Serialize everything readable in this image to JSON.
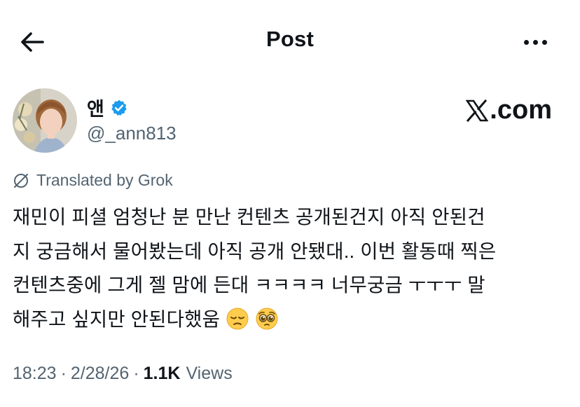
{
  "header": {
    "title": "Post",
    "back_icon": "arrow-left-icon",
    "more_icon": "more-horizontal-icon"
  },
  "author": {
    "name": "앤",
    "handle": "@_ann813",
    "verified_icon": "verified-badge-icon",
    "verified_color": "#1d9bf0"
  },
  "brand": {
    "suffix": ".com",
    "icon": "x-logo-icon"
  },
  "translation": {
    "label": "Translated by Grok",
    "icon": "translate-icon"
  },
  "post": {
    "lines": [
      "재민이 피셜 엄청난 분 만난 컨텐츠 공개된건지 아직 안된건",
      "지 궁금해서 물어봤는데 아직 공개 안됐대.. 이번 활동때 찍은",
      "컨텐츠중에 그게 젤 맘에 든대 ㅋㅋㅋㅋ 너무궁금 ㅜㅜㅜ  말",
      "해주고 싶지만 안된다했움"
    ],
    "emojis": [
      "pensive-face-emoji",
      "pleading-face-emoji"
    ]
  },
  "meta": {
    "time": "18:23",
    "separator": "·",
    "date": "2/28/26",
    "views_count": "1.1K",
    "views_label": "Views"
  },
  "colors": {
    "text": "#0f1419",
    "secondary": "#536471",
    "accent": "#1d9bf0"
  }
}
